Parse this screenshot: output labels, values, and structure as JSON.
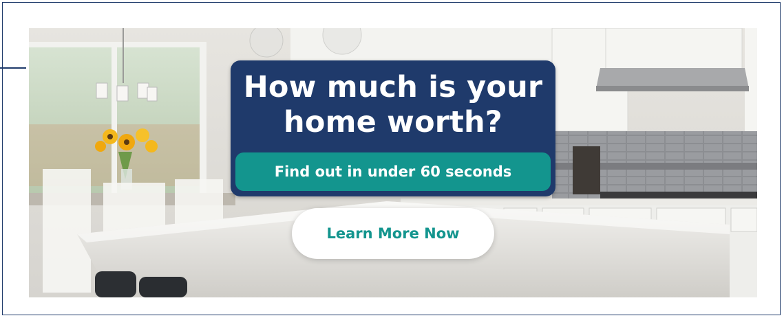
{
  "ad": {
    "headline": "How much is your home worth?",
    "subheadline": "Find out in under 60 seconds",
    "cta_label": "Learn More Now",
    "background_image": "kitchen-photo",
    "colors": {
      "navy": "#1f3a6b",
      "teal": "#13958e",
      "white": "#ffffff",
      "border": "#1e3a6a"
    }
  }
}
